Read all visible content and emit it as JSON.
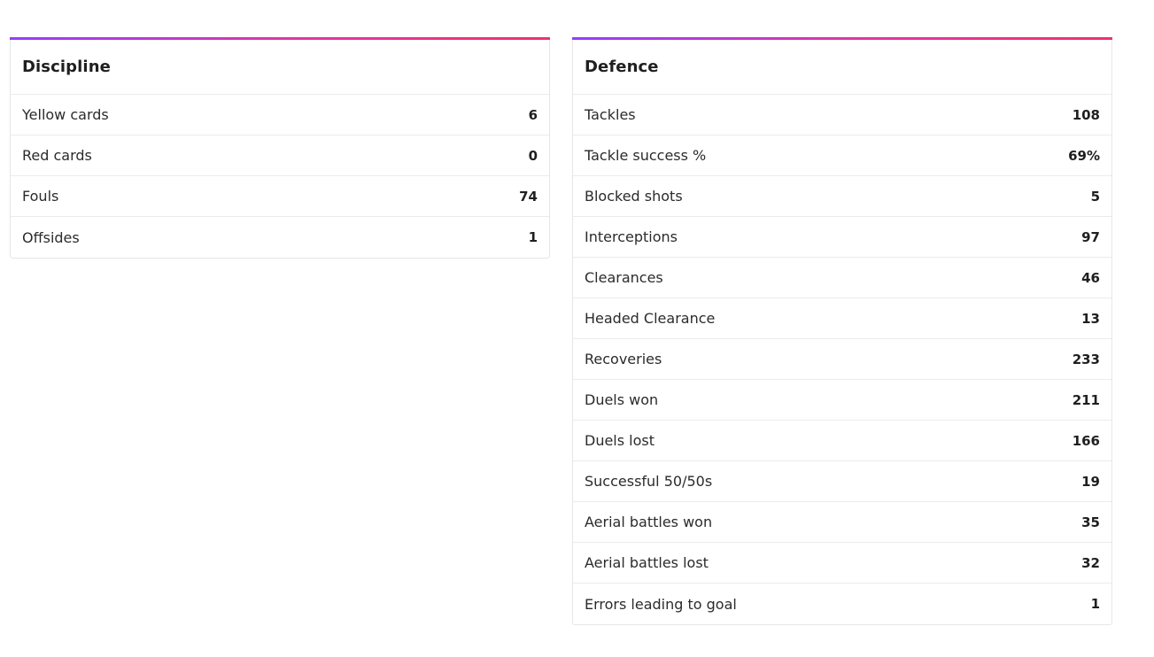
{
  "discipline": {
    "title": "Discipline",
    "rows": [
      {
        "label": "Yellow cards",
        "value": "6"
      },
      {
        "label": "Red cards",
        "value": "0"
      },
      {
        "label": "Fouls",
        "value": "74"
      },
      {
        "label": "Offsides",
        "value": "1"
      }
    ]
  },
  "defence": {
    "title": "Defence",
    "rows": [
      {
        "label": "Tackles",
        "value": "108"
      },
      {
        "label": "Tackle success %",
        "value": "69%"
      },
      {
        "label": "Blocked shots",
        "value": "5"
      },
      {
        "label": "Interceptions",
        "value": "97"
      },
      {
        "label": "Clearances",
        "value": "46"
      },
      {
        "label": "Headed Clearance",
        "value": "13"
      },
      {
        "label": "Recoveries",
        "value": "233"
      },
      {
        "label": "Duels won",
        "value": "211"
      },
      {
        "label": "Duels lost",
        "value": "166"
      },
      {
        "label": "Successful 50/50s",
        "value": "19"
      },
      {
        "label": "Aerial battles won",
        "value": "35"
      },
      {
        "label": "Aerial battles lost",
        "value": "32"
      },
      {
        "label": "Errors leading to goal",
        "value": "1"
      }
    ]
  },
  "colors": {
    "accent_start": "#963cff",
    "accent_end": "#f0306e"
  }
}
